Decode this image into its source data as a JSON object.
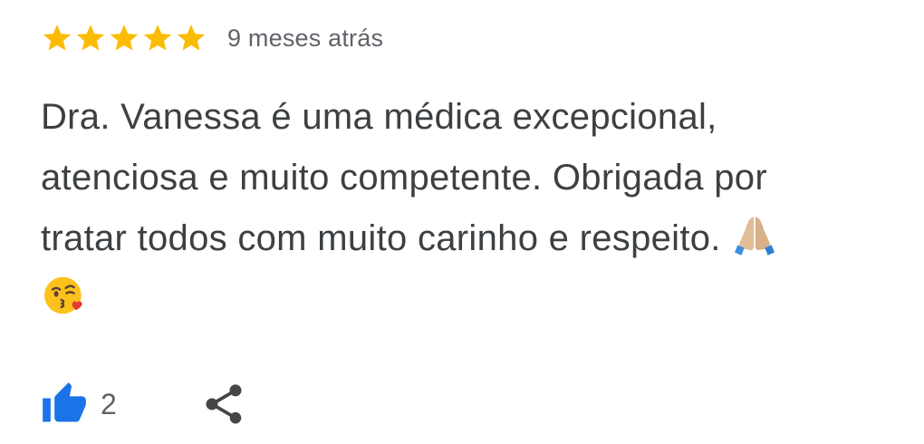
{
  "review": {
    "rating": 5,
    "rating_max": 5,
    "time_ago": "9 meses atrás",
    "text": "Dra. Vanessa é uma médica excepcional,\natenciosa e muito competente. Obrigada por\ntratar todos com muito carinho e respeito. ",
    "emojis": [
      "folded-hands",
      "face-blowing-kiss"
    ],
    "like_count": "2"
  },
  "icons": {
    "star": "star-icon",
    "like": "thumb-up-icon",
    "share": "share-icon"
  },
  "colors": {
    "star": "#fbbc04",
    "like_blue": "#1a73e8",
    "text": "#3c4043",
    "secondary": "#5f6368",
    "share_icon": "#444746"
  }
}
